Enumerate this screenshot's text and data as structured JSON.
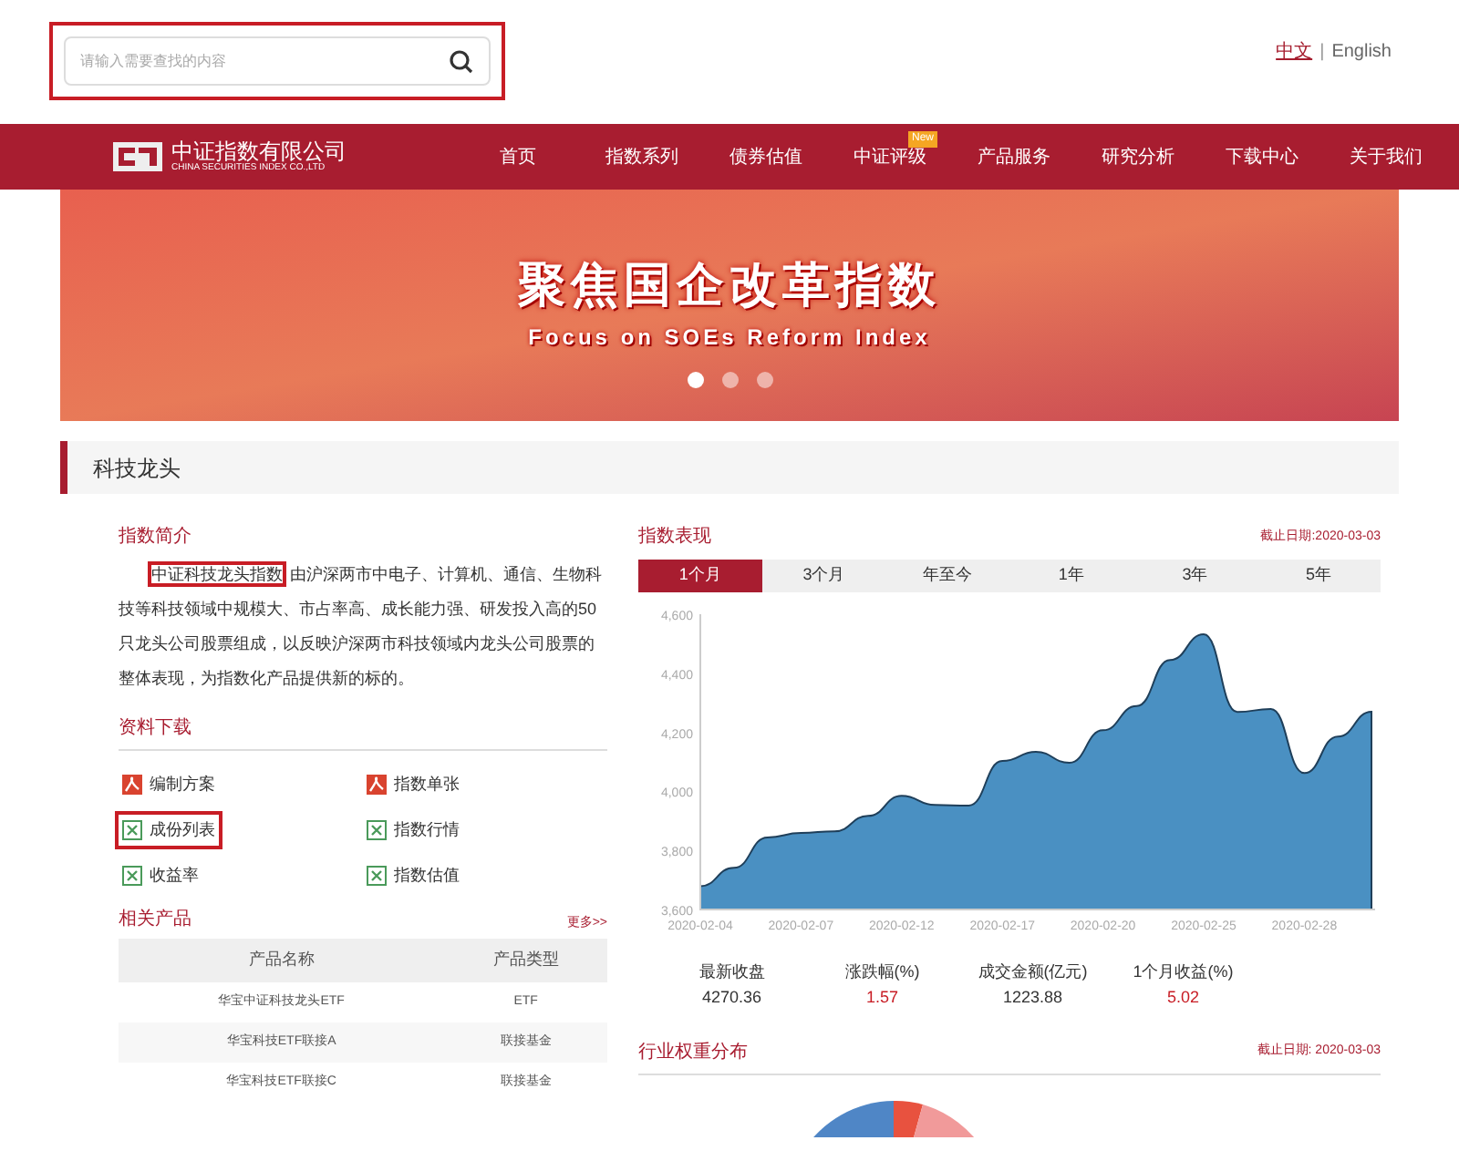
{
  "search": {
    "placeholder": "请输入需要查找的内容",
    "highlighted": true
  },
  "language_separator": "|",
  "languages": [
    {
      "label": "中文",
      "selected": true
    },
    {
      "label": "English",
      "selected": false
    }
  ],
  "logo": {
    "name": "中证指数有限公司",
    "subtitle": "CHINA SECURITIES INDEX CO.,LTD"
  },
  "nav": [
    {
      "label": "首页"
    },
    {
      "label": "指数系列"
    },
    {
      "label": "债券估值"
    },
    {
      "label": "中证评级",
      "badge": "New"
    },
    {
      "label": "产品服务"
    },
    {
      "label": "研究分析"
    },
    {
      "label": "下载中心"
    },
    {
      "label": "关于我们"
    }
  ],
  "banner": {
    "title": "聚焦国企改革指数",
    "subtitle": "Focus on SOEs Reform Index",
    "dots": [
      {
        "selected": true
      },
      {
        "selected": false
      },
      {
        "selected": false
      }
    ]
  },
  "page_title": "科技龙头",
  "intro": {
    "heading": "指数简介",
    "highlighted_part": "中证科技龙头指数",
    "text": "由沪深两市中电子、计算机、通信、生物科技等科技领域中规模大、市占率高、成长能力强、研发投入高的50只龙头公司股票组成，以反映沪深两市科技领域内龙头公司股票的整体表现，为指数化产品提供新的标的。"
  },
  "downloads": {
    "heading": "资料下载",
    "items": [
      {
        "label": "编制方案",
        "kind": "pdf",
        "highlighted": false
      },
      {
        "label": "指数单张",
        "kind": "pdf",
        "highlighted": false
      },
      {
        "label": "成份列表",
        "kind": "excel",
        "highlighted": true
      },
      {
        "label": "指数行情",
        "kind": "excel",
        "highlighted": false
      },
      {
        "label": "收益率",
        "kind": "excel",
        "highlighted": false
      },
      {
        "label": "指数估值",
        "kind": "excel",
        "highlighted": false
      }
    ]
  },
  "products": {
    "heading": "相关产品",
    "more": "更多>>",
    "columns": [
      "产品名称",
      "产品类型"
    ],
    "rows": [
      [
        "华宝中证科技龙头ETF",
        "ETF"
      ],
      [
        "华宝科技ETF联接A",
        "联接基金"
      ],
      [
        "华宝科技ETF联接C",
        "联接基金"
      ]
    ]
  },
  "performance": {
    "heading": "指数表现",
    "as_of": "截止日期:2020-03-03",
    "tabs": [
      {
        "label": "1个月",
        "selected": true
      },
      {
        "label": "3个月",
        "selected": false
      },
      {
        "label": "年至今",
        "selected": false
      },
      {
        "label": "1年",
        "selected": false
      },
      {
        "label": "3年",
        "selected": false
      },
      {
        "label": "5年",
        "selected": false
      }
    ],
    "chart_data": {
      "type": "area",
      "categories": [
        "2020-02-04",
        null,
        null,
        "2020-02-07",
        null,
        null,
        "2020-02-12",
        null,
        null,
        "2020-02-17",
        null,
        null,
        "2020-02-20",
        null,
        null,
        "2020-02-25",
        null,
        null,
        "2020-02-28",
        null,
        null
      ],
      "series": [
        {
          "color": "#4a90c2",
          "values": [
            3679,
            3741,
            3844,
            3859,
            3865,
            3917,
            3985,
            3954,
            3952,
            4103,
            4134,
            4097,
            4207,
            4289,
            4445,
            4532,
            4269,
            4279,
            4062,
            4186,
            4270
          ]
        }
      ],
      "ylim": [
        3600,
        4600
      ],
      "yticks": [
        {
          "value": 3600,
          "label": "3,600"
        },
        {
          "value": 3800,
          "label": "3,800"
        },
        {
          "value": 4000,
          "label": "4,000"
        },
        {
          "value": 4200,
          "label": "4,200"
        },
        {
          "value": 4400,
          "label": "4,400"
        },
        {
          "value": 4600,
          "label": "4,600"
        }
      ]
    },
    "stats": [
      {
        "label": "最新收盘",
        "value": "4270.36",
        "color": "#333333"
      },
      {
        "label": "涨跌幅(%)",
        "value": "1.57",
        "color": "#c81d25"
      },
      {
        "label": "成交金额(亿元)",
        "value": "1223.88",
        "color": "#333333"
      },
      {
        "label": "1个月收益(%)",
        "value": "5.02",
        "color": "#c81d25"
      }
    ]
  },
  "industry": {
    "heading": "行业权重分布",
    "as_of": "截止日期: 2020-03-03"
  }
}
